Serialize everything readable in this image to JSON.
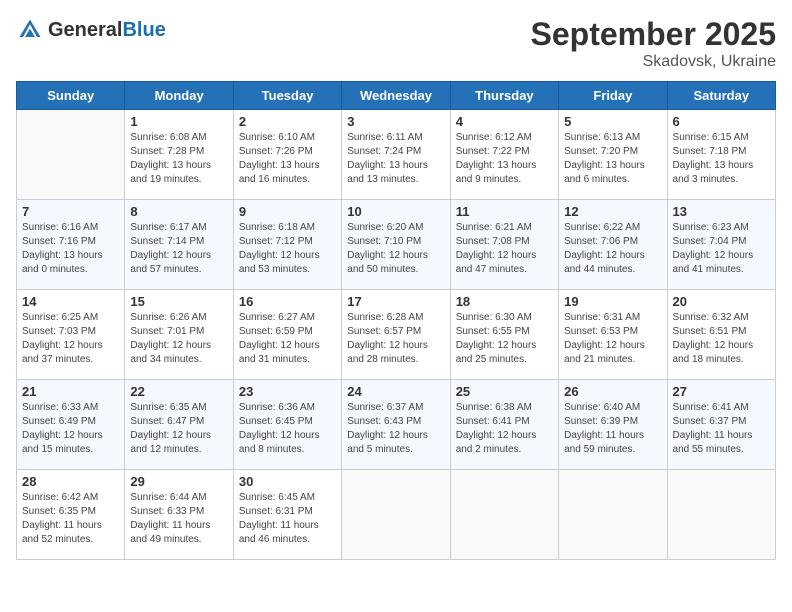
{
  "header": {
    "logo_general": "General",
    "logo_blue": "Blue",
    "month_title": "September 2025",
    "location": "Skadovsk, Ukraine"
  },
  "days_of_week": [
    "Sunday",
    "Monday",
    "Tuesday",
    "Wednesday",
    "Thursday",
    "Friday",
    "Saturday"
  ],
  "weeks": [
    [
      {
        "day": "",
        "sunrise": "",
        "sunset": "",
        "daylight": ""
      },
      {
        "day": "1",
        "sunrise": "Sunrise: 6:08 AM",
        "sunset": "Sunset: 7:28 PM",
        "daylight": "Daylight: 13 hours and 19 minutes."
      },
      {
        "day": "2",
        "sunrise": "Sunrise: 6:10 AM",
        "sunset": "Sunset: 7:26 PM",
        "daylight": "Daylight: 13 hours and 16 minutes."
      },
      {
        "day": "3",
        "sunrise": "Sunrise: 6:11 AM",
        "sunset": "Sunset: 7:24 PM",
        "daylight": "Daylight: 13 hours and 13 minutes."
      },
      {
        "day": "4",
        "sunrise": "Sunrise: 6:12 AM",
        "sunset": "Sunset: 7:22 PM",
        "daylight": "Daylight: 13 hours and 9 minutes."
      },
      {
        "day": "5",
        "sunrise": "Sunrise: 6:13 AM",
        "sunset": "Sunset: 7:20 PM",
        "daylight": "Daylight: 13 hours and 6 minutes."
      },
      {
        "day": "6",
        "sunrise": "Sunrise: 6:15 AM",
        "sunset": "Sunset: 7:18 PM",
        "daylight": "Daylight: 13 hours and 3 minutes."
      }
    ],
    [
      {
        "day": "7",
        "sunrise": "Sunrise: 6:16 AM",
        "sunset": "Sunset: 7:16 PM",
        "daylight": "Daylight: 13 hours and 0 minutes."
      },
      {
        "day": "8",
        "sunrise": "Sunrise: 6:17 AM",
        "sunset": "Sunset: 7:14 PM",
        "daylight": "Daylight: 12 hours and 57 minutes."
      },
      {
        "day": "9",
        "sunrise": "Sunrise: 6:18 AM",
        "sunset": "Sunset: 7:12 PM",
        "daylight": "Daylight: 12 hours and 53 minutes."
      },
      {
        "day": "10",
        "sunrise": "Sunrise: 6:20 AM",
        "sunset": "Sunset: 7:10 PM",
        "daylight": "Daylight: 12 hours and 50 minutes."
      },
      {
        "day": "11",
        "sunrise": "Sunrise: 6:21 AM",
        "sunset": "Sunset: 7:08 PM",
        "daylight": "Daylight: 12 hours and 47 minutes."
      },
      {
        "day": "12",
        "sunrise": "Sunrise: 6:22 AM",
        "sunset": "Sunset: 7:06 PM",
        "daylight": "Daylight: 12 hours and 44 minutes."
      },
      {
        "day": "13",
        "sunrise": "Sunrise: 6:23 AM",
        "sunset": "Sunset: 7:04 PM",
        "daylight": "Daylight: 12 hours and 41 minutes."
      }
    ],
    [
      {
        "day": "14",
        "sunrise": "Sunrise: 6:25 AM",
        "sunset": "Sunset: 7:03 PM",
        "daylight": "Daylight: 12 hours and 37 minutes."
      },
      {
        "day": "15",
        "sunrise": "Sunrise: 6:26 AM",
        "sunset": "Sunset: 7:01 PM",
        "daylight": "Daylight: 12 hours and 34 minutes."
      },
      {
        "day": "16",
        "sunrise": "Sunrise: 6:27 AM",
        "sunset": "Sunset: 6:59 PM",
        "daylight": "Daylight: 12 hours and 31 minutes."
      },
      {
        "day": "17",
        "sunrise": "Sunrise: 6:28 AM",
        "sunset": "Sunset: 6:57 PM",
        "daylight": "Daylight: 12 hours and 28 minutes."
      },
      {
        "day": "18",
        "sunrise": "Sunrise: 6:30 AM",
        "sunset": "Sunset: 6:55 PM",
        "daylight": "Daylight: 12 hours and 25 minutes."
      },
      {
        "day": "19",
        "sunrise": "Sunrise: 6:31 AM",
        "sunset": "Sunset: 6:53 PM",
        "daylight": "Daylight: 12 hours and 21 minutes."
      },
      {
        "day": "20",
        "sunrise": "Sunrise: 6:32 AM",
        "sunset": "Sunset: 6:51 PM",
        "daylight": "Daylight: 12 hours and 18 minutes."
      }
    ],
    [
      {
        "day": "21",
        "sunrise": "Sunrise: 6:33 AM",
        "sunset": "Sunset: 6:49 PM",
        "daylight": "Daylight: 12 hours and 15 minutes."
      },
      {
        "day": "22",
        "sunrise": "Sunrise: 6:35 AM",
        "sunset": "Sunset: 6:47 PM",
        "daylight": "Daylight: 12 hours and 12 minutes."
      },
      {
        "day": "23",
        "sunrise": "Sunrise: 6:36 AM",
        "sunset": "Sunset: 6:45 PM",
        "daylight": "Daylight: 12 hours and 8 minutes."
      },
      {
        "day": "24",
        "sunrise": "Sunrise: 6:37 AM",
        "sunset": "Sunset: 6:43 PM",
        "daylight": "Daylight: 12 hours and 5 minutes."
      },
      {
        "day": "25",
        "sunrise": "Sunrise: 6:38 AM",
        "sunset": "Sunset: 6:41 PM",
        "daylight": "Daylight: 12 hours and 2 minutes."
      },
      {
        "day": "26",
        "sunrise": "Sunrise: 6:40 AM",
        "sunset": "Sunset: 6:39 PM",
        "daylight": "Daylight: 11 hours and 59 minutes."
      },
      {
        "day": "27",
        "sunrise": "Sunrise: 6:41 AM",
        "sunset": "Sunset: 6:37 PM",
        "daylight": "Daylight: 11 hours and 55 minutes."
      }
    ],
    [
      {
        "day": "28",
        "sunrise": "Sunrise: 6:42 AM",
        "sunset": "Sunset: 6:35 PM",
        "daylight": "Daylight: 11 hours and 52 minutes."
      },
      {
        "day": "29",
        "sunrise": "Sunrise: 6:44 AM",
        "sunset": "Sunset: 6:33 PM",
        "daylight": "Daylight: 11 hours and 49 minutes."
      },
      {
        "day": "30",
        "sunrise": "Sunrise: 6:45 AM",
        "sunset": "Sunset: 6:31 PM",
        "daylight": "Daylight: 11 hours and 46 minutes."
      },
      {
        "day": "",
        "sunrise": "",
        "sunset": "",
        "daylight": ""
      },
      {
        "day": "",
        "sunrise": "",
        "sunset": "",
        "daylight": ""
      },
      {
        "day": "",
        "sunrise": "",
        "sunset": "",
        "daylight": ""
      },
      {
        "day": "",
        "sunrise": "",
        "sunset": "",
        "daylight": ""
      }
    ]
  ]
}
